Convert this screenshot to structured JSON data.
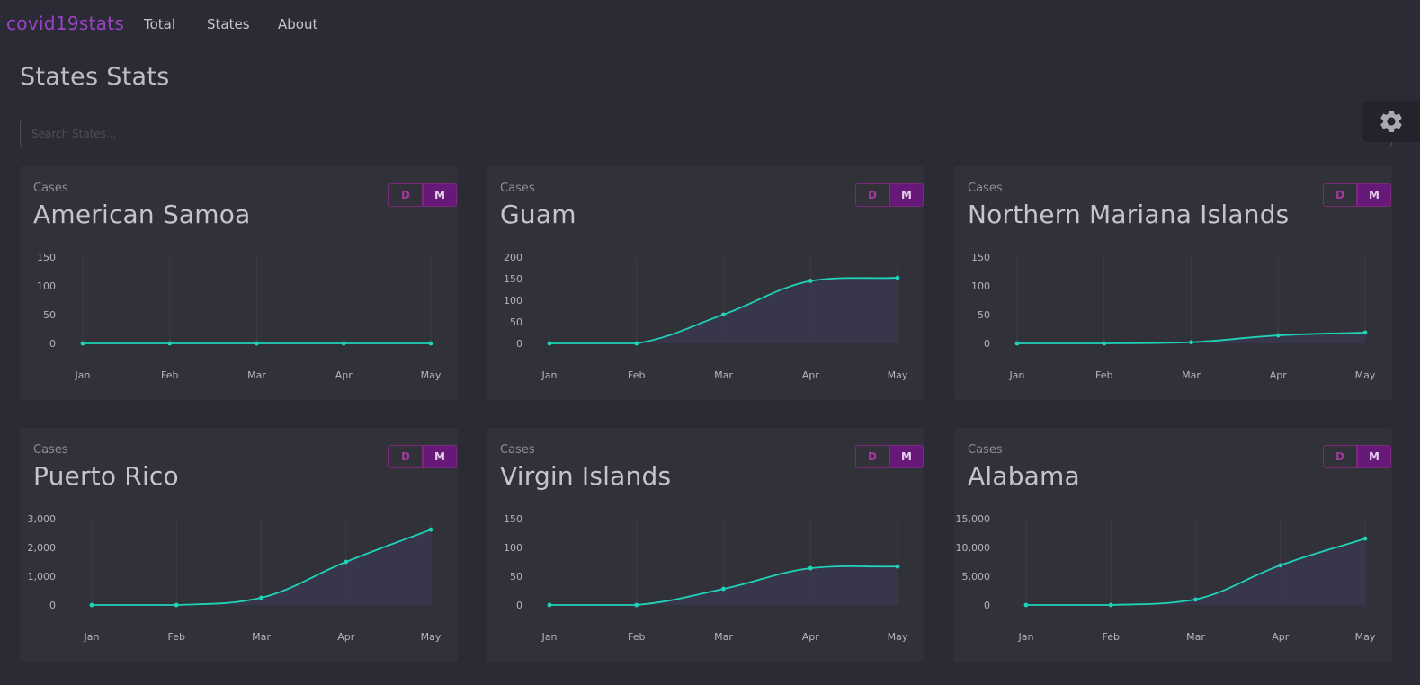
{
  "brand": "covid19stats",
  "nav": [
    "Total",
    "States",
    "About"
  ],
  "page_title": "States Stats",
  "search": {
    "placeholder": "Search States..."
  },
  "settings_icon": "gear-icon",
  "colors": {
    "accent": "#9b42c7",
    "line": "#1fd3b7",
    "toggle_active": "#67197a",
    "card": "#313139",
    "background": "#2b2b35"
  },
  "cards": [
    {
      "subtitle": "Cases",
      "title": "American Samoa",
      "toggle": [
        "D",
        "M"
      ],
      "selected": "M"
    },
    {
      "subtitle": "Cases",
      "title": "Guam",
      "toggle": [
        "D",
        "M"
      ],
      "selected": "M"
    },
    {
      "subtitle": "Cases",
      "title": "Northern Mariana Islands",
      "toggle": [
        "D",
        "M"
      ],
      "selected": "M"
    },
    {
      "subtitle": "Cases",
      "title": "Puerto Rico",
      "toggle": [
        "D",
        "M"
      ],
      "selected": "M"
    },
    {
      "subtitle": "Cases",
      "title": "Virgin Islands",
      "toggle": [
        "D",
        "M"
      ],
      "selected": "M"
    },
    {
      "subtitle": "Cases",
      "title": "Alabama",
      "toggle": [
        "D",
        "M"
      ],
      "selected": "M"
    }
  ],
  "chart_data": [
    {
      "type": "line",
      "categories": [
        "Jan",
        "Feb",
        "Mar",
        "Apr",
        "May"
      ],
      "values": [
        0,
        0,
        0,
        0,
        0
      ],
      "yticks": [
        0,
        50,
        100,
        150
      ],
      "ylim": [
        0,
        150
      ],
      "ytick_labels": [
        "0",
        "50",
        "100",
        "150"
      ]
    },
    {
      "type": "line",
      "categories": [
        "Jan",
        "Feb",
        "Mar",
        "Apr",
        "May"
      ],
      "values": [
        0,
        0,
        67,
        145,
        152
      ],
      "yticks": [
        0,
        50,
        100,
        150,
        200
      ],
      "ylim": [
        0,
        200
      ],
      "ytick_labels": [
        "0",
        "50",
        "100",
        "150",
        "200"
      ]
    },
    {
      "type": "line",
      "categories": [
        "Jan",
        "Feb",
        "Mar",
        "Apr",
        "May"
      ],
      "values": [
        0,
        0,
        2,
        14,
        19
      ],
      "yticks": [
        0,
        50,
        100,
        150
      ],
      "ylim": [
        0,
        150
      ],
      "ytick_labels": [
        "0",
        "50",
        "100",
        "150"
      ]
    },
    {
      "type": "line",
      "categories": [
        "Jan",
        "Feb",
        "Mar",
        "Apr",
        "May"
      ],
      "values": [
        0,
        0,
        250,
        1500,
        2620
      ],
      "yticks": [
        0,
        1000,
        2000,
        3000
      ],
      "ylim": [
        0,
        3000
      ],
      "ytick_labels": [
        "0",
        "1,000",
        "2,000",
        "3,000"
      ]
    },
    {
      "type": "line",
      "categories": [
        "Jan",
        "Feb",
        "Mar",
        "Apr",
        "May"
      ],
      "values": [
        0,
        0,
        28,
        64,
        67
      ],
      "yticks": [
        0,
        50,
        100,
        150
      ],
      "ylim": [
        0,
        150
      ],
      "ytick_labels": [
        "0",
        "50",
        "100",
        "150"
      ]
    },
    {
      "type": "line",
      "categories": [
        "Jan",
        "Feb",
        "Mar",
        "Apr",
        "May"
      ],
      "values": [
        0,
        0,
        950,
        6900,
        11550
      ],
      "yticks": [
        0,
        5000,
        10000,
        15000
      ],
      "ylim": [
        0,
        15000
      ],
      "ytick_labels": [
        "0",
        "5,000",
        "10,000",
        "15,000"
      ]
    }
  ]
}
